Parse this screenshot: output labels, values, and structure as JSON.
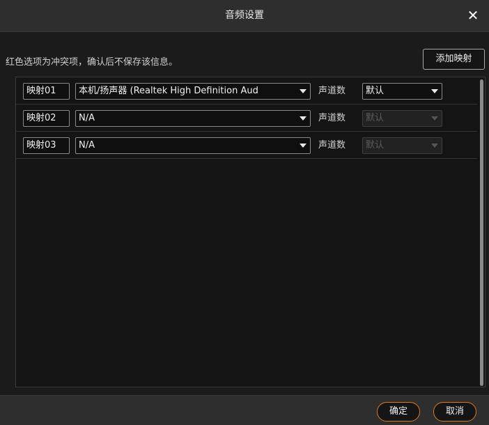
{
  "dialog": {
    "title": "音频设置",
    "close_glyph": "✕",
    "hint": "红色选项为冲突项，确认后不保存该信息。",
    "add_button_label": "添加映射"
  },
  "mappings": [
    {
      "label": "映射01",
      "device": "本机/扬声器 (Realtek High Definition Aud",
      "channel_label": "声道数",
      "channel_value": "默认",
      "channel_enabled": true
    },
    {
      "label": "映射02",
      "device": "N/A",
      "channel_label": "声道数",
      "channel_value": "默认",
      "channel_enabled": false
    },
    {
      "label": "映射03",
      "device": "N/A",
      "channel_label": "声道数",
      "channel_value": "默认",
      "channel_enabled": false
    }
  ],
  "footer": {
    "confirm_label": "确定",
    "cancel_label": "取消"
  },
  "colors": {
    "accent": "#e0781f",
    "background": "#1b1b1b"
  }
}
